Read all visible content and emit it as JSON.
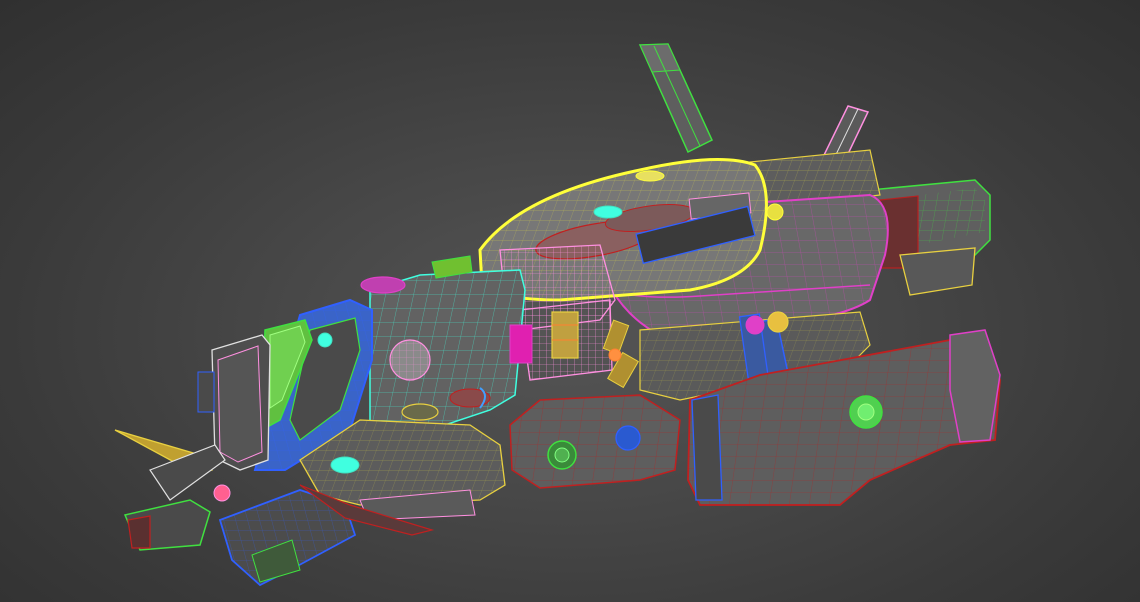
{
  "viewport": {
    "background": "#3a3a3a",
    "object": "spaceship-wireframe-model"
  },
  "colors": {
    "shaded_surface": "#6a6a6a",
    "shaded_dark": "#4a4a4a",
    "selection_highlight": "#ffff3a",
    "wire_magenta": "#e040c8",
    "wire_green": "#40e040",
    "wire_cyan": "#40ffe0",
    "wire_pink": "#ff90e0",
    "wire_blue": "#3060ff",
    "wire_yellow": "#e8d040",
    "wire_red": "#c02020",
    "wire_orange": "#ff8030",
    "wire_white": "#e0e0e0"
  }
}
